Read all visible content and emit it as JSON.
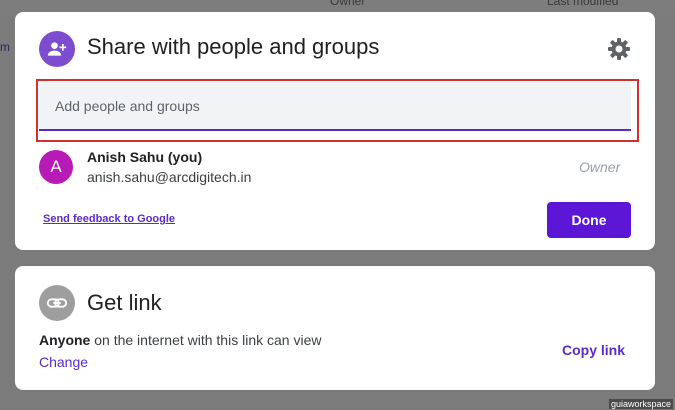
{
  "background": {
    "col_owner": "Owner",
    "col_modified": "Last modified",
    "left_fragment": "m"
  },
  "share_dialog": {
    "title": "Share with people and groups",
    "input_placeholder": "Add people and groups",
    "user": {
      "avatar_letter": "A",
      "name": "Anish Sahu (you)",
      "email": "anish.sahu@arcdigitech.in",
      "role": "Owner"
    },
    "feedback_label": "Send feedback to Google",
    "done_label": "Done",
    "icons": {
      "header": "person-add-icon",
      "settings": "gear-icon"
    }
  },
  "link_dialog": {
    "title": "Get link",
    "scope": "Anyone",
    "description_rest": " on the internet with this link can view",
    "change_label": "Change",
    "copy_label": "Copy link",
    "icons": {
      "header": "link-icon"
    }
  },
  "colors": {
    "accent": "#5b16d6",
    "share_icon_bg": "#7c4dce",
    "avatar_bg": "#b81ab5",
    "highlight": "#d32f2f"
  },
  "watermark": "guiaworkspace"
}
